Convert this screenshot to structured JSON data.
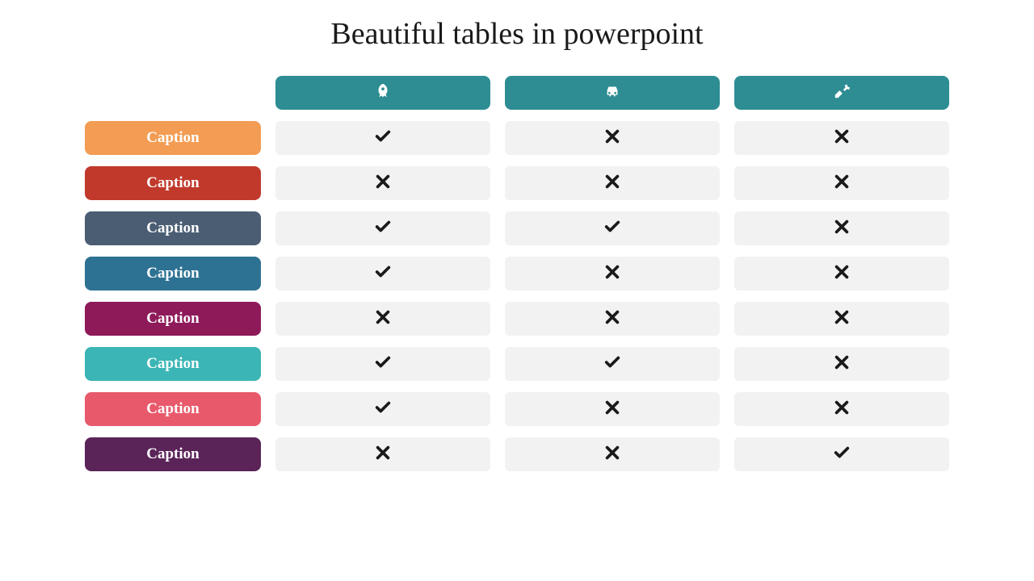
{
  "title": "Beautiful tables in powerpoint",
  "headers": [
    {
      "icon": "rocket-icon",
      "color": "#2d8d93"
    },
    {
      "icon": "car-icon",
      "color": "#2d8d93"
    },
    {
      "icon": "tools-icon",
      "color": "#2d8d93"
    }
  ],
  "rows": [
    {
      "label": "Caption",
      "color": "#f39c53",
      "values": [
        true,
        false,
        false
      ]
    },
    {
      "label": "Caption",
      "color": "#c0392b",
      "values": [
        false,
        false,
        false
      ]
    },
    {
      "label": "Caption",
      "color": "#4a5d73",
      "values": [
        true,
        true,
        false
      ]
    },
    {
      "label": "Caption",
      "color": "#2d7293",
      "values": [
        true,
        false,
        false
      ]
    },
    {
      "label": "Caption",
      "color": "#8e1a5a",
      "values": [
        false,
        false,
        false
      ]
    },
    {
      "label": "Caption",
      "color": "#3bb5b5",
      "values": [
        true,
        true,
        false
      ]
    },
    {
      "label": "Caption",
      "color": "#e85a6b",
      "values": [
        true,
        false,
        false
      ]
    },
    {
      "label": "Caption",
      "color": "#5a2458",
      "values": [
        false,
        false,
        true
      ]
    }
  ]
}
